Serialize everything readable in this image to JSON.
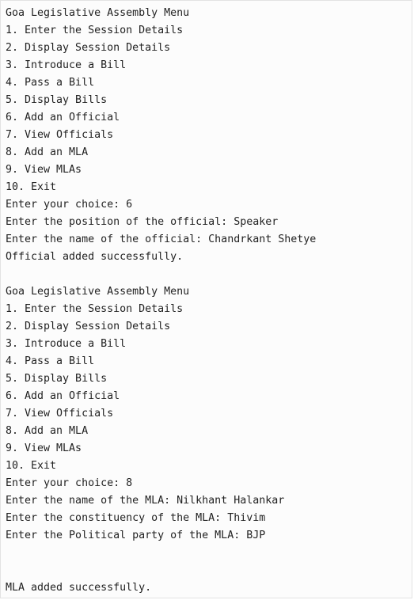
{
  "console": {
    "lines": [
      "Goa Legislative Assembly Menu",
      "1. Enter the Session Details",
      "2. Display Session Details",
      "3. Introduce a Bill",
      "4. Pass a Bill",
      "5. Display Bills",
      "6. Add an Official",
      "7. View Officials",
      "8. Add an MLA",
      "9. View MLAs",
      "10. Exit",
      "Enter your choice: 6",
      "Enter the position of the official: Speaker",
      "Enter the name of the official: Chandrkant Shetye",
      "Official added successfully.",
      "",
      "Goa Legislative Assembly Menu",
      "1. Enter the Session Details",
      "2. Display Session Details",
      "3. Introduce a Bill",
      "4. Pass a Bill",
      "5. Display Bills",
      "6. Add an Official",
      "7. View Officials",
      "8. Add an MLA",
      "9. View MLAs",
      "10. Exit",
      "Enter your choice: 8",
      "Enter the name of the MLA: Nilkhant Halankar",
      "Enter the constituency of the MLA: Thivim",
      "Enter the Political party of the MLA: BJP",
      "",
      "",
      "MLA added successfully."
    ]
  }
}
